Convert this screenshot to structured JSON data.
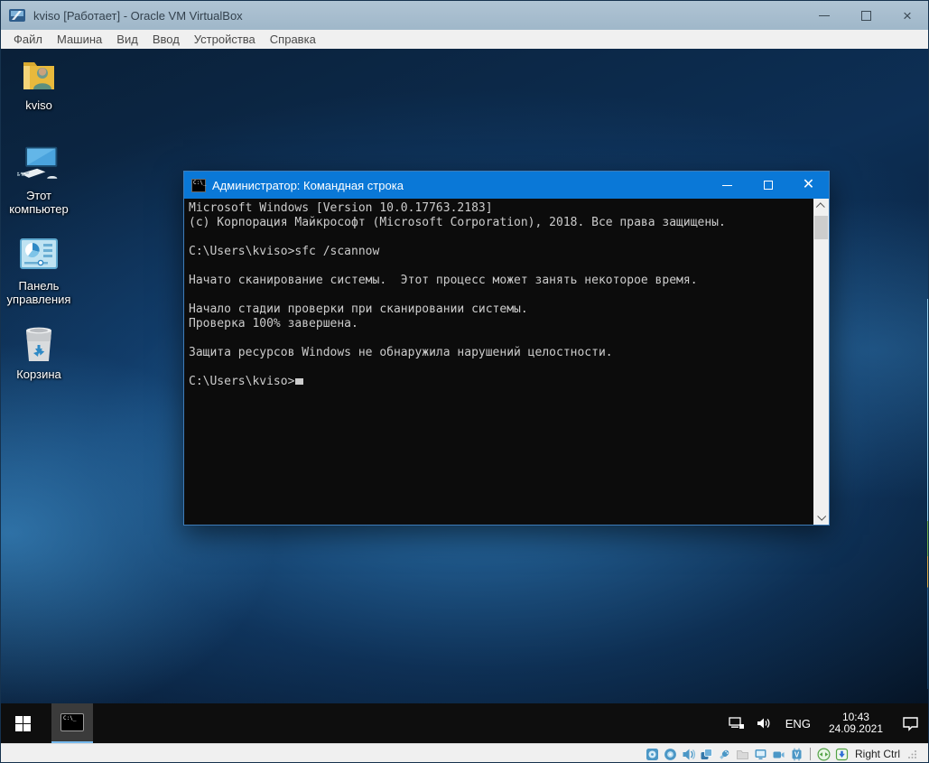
{
  "vbox": {
    "window_title": "kviso [Работает] - Oracle VM VirtualBox",
    "menu_items": [
      "Файл",
      "Машина",
      "Вид",
      "Ввод",
      "Устройства",
      "Справка"
    ],
    "host_key_label": "Right Ctrl",
    "status_icons": [
      "hard-disks",
      "optical-drives",
      "audio",
      "network",
      "usb",
      "shared-folders",
      "display",
      "recording",
      "features",
      "mouse-integration",
      "keyboard"
    ]
  },
  "desktop": {
    "icons": [
      {
        "label": "kviso"
      },
      {
        "line1": "Этот",
        "line2": "компьютер"
      },
      {
        "line1": "Панель",
        "line2": "управления"
      },
      {
        "label": "Корзина"
      }
    ]
  },
  "cmd": {
    "title": "Администратор: Командная строка",
    "lines": [
      "Microsoft Windows [Version 10.0.17763.2183]",
      "(c) Корпорация Майкрософт (Microsoft Corporation), 2018. Все права защищены.",
      "",
      "C:\\Users\\kviso>sfc /scannow",
      "",
      "Начато сканирование системы.  Этот процесс может занять некоторое время.",
      "",
      "Начало стадии проверки при сканировании системы.",
      "Проверка 100% завершена.",
      "",
      "Защита ресурсов Windows не обнаружила нарушений целостности.",
      "",
      "C:\\Users\\kviso>"
    ]
  },
  "taskbar": {
    "language": "ENG",
    "time": "10:43",
    "date": "24.09.2021"
  },
  "colors": {
    "cmd_titlebar": "#0a78d7",
    "vbox_titlebar": "#a7bdcf",
    "taskbar": "#0e0e0e",
    "accent_underline": "#76b9ed",
    "console_text": "#cccccc"
  }
}
